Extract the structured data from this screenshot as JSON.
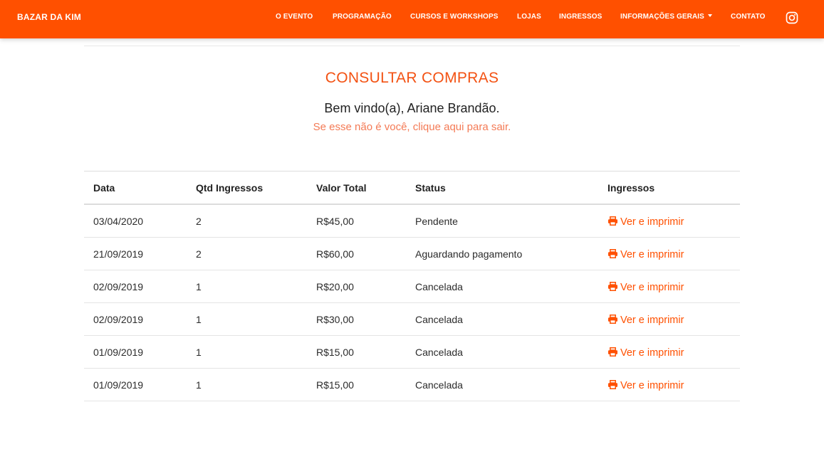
{
  "colors": {
    "brand": "#ff5000",
    "title": "#f35213",
    "logout_link": "#f47a55"
  },
  "nav": {
    "brand": "BAZAR DA KIM",
    "items": [
      "O EVENTO",
      "PROGRAMAÇÃO",
      "CURSOS E WORKSHOPS",
      "LOJAS",
      "INGRESSOS",
      "INFORMAÇÕES GERAIS",
      "CONTATO"
    ],
    "social_icon": "instagram-icon"
  },
  "page": {
    "title": "CONSULTAR COMPRAS",
    "welcome": "Bem vindo(a), Ariane Brandão.",
    "logout_text": "Se esse não é você, clique aqui para sair."
  },
  "table": {
    "headers": [
      "Data",
      "Qtd Ingressos",
      "Valor Total",
      "Status",
      "Ingressos"
    ],
    "rows": [
      {
        "date": "03/04/2020",
        "qty": "2",
        "total": "R$45,00",
        "status": "Pendente",
        "action": "Ver e imprimir"
      },
      {
        "date": "21/09/2019",
        "qty": "2",
        "total": "R$60,00",
        "status": "Aguardando pagamento",
        "action": "Ver e imprimir"
      },
      {
        "date": "02/09/2019",
        "qty": "1",
        "total": "R$20,00",
        "status": "Cancelada",
        "action": "Ver e imprimir"
      },
      {
        "date": "02/09/2019",
        "qty": "1",
        "total": "R$30,00",
        "status": "Cancelada",
        "action": "Ver e imprimir"
      },
      {
        "date": "01/09/2019",
        "qty": "1",
        "total": "R$15,00",
        "status": "Cancelada",
        "action": "Ver e imprimir"
      },
      {
        "date": "01/09/2019",
        "qty": "1",
        "total": "R$15,00",
        "status": "Cancelada",
        "action": "Ver e imprimir"
      }
    ],
    "action_icon": "printer-icon"
  }
}
